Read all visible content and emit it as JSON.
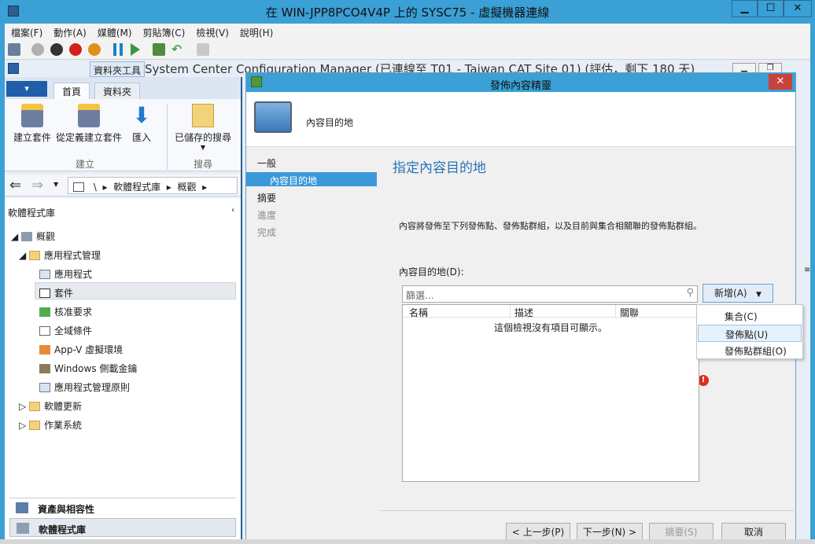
{
  "vm_window": {
    "title": "在 WIN-JPP8PCO4V4P 上的 SYSC75 - 虛擬機器連線",
    "minimize": "▁",
    "maximize": "☐",
    "close": "✕",
    "menu": [
      "檔案(F)",
      "動作(A)",
      "媒體(M)",
      "剪貼簿(C)",
      "檢視(V)",
      "說明(H)"
    ]
  },
  "cm_window": {
    "title": "System Center Configuration Manager (已連線至 T01 - Taiwan CAT Site 01) (評估，剩下 180 天)",
    "folder_tools": "資料夾工具",
    "tabs": [
      "首頁",
      "資料夾"
    ],
    "ribbon_buttons": [
      "建立套件",
      "從定義建立套件",
      "匯入",
      "已儲存的搜尋"
    ],
    "ribbon_groups": [
      "建立",
      "搜尋"
    ],
    "breadcrumb": [
      "\\",
      "軟體程式庫",
      "概觀"
    ],
    "sidebar_title": "軟體程式庫",
    "tree": {
      "overview": "概觀",
      "app_mgmt": "應用程式管理",
      "items": [
        "應用程式",
        "套件",
        "核准要求",
        "全域條件",
        "App-V 虛擬環境",
        "Windows 側載金鑰",
        "應用程式管理原則"
      ],
      "software_updates": "軟體更新",
      "os": "作業系統"
    },
    "workspaces": [
      "資產與相容性",
      "軟體程式庫"
    ]
  },
  "wizard": {
    "title": "發佈內容精靈",
    "header": "內容目的地",
    "steps": [
      "一般",
      "內容目的地",
      "摘要",
      "進度",
      "完成"
    ],
    "active_step": 1,
    "heading": "指定內容目的地",
    "description": "內容將發佈至下列發佈點、發佈點群組，以及目前與集合相關聯的發佈點群組。",
    "list_label": "內容目的地(D):",
    "filter_placeholder": "篩選...",
    "columns": [
      "名稱",
      "描述",
      "關聯"
    ],
    "empty_message": "這個檢視沒有項目可顯示。",
    "add_button": "新增(A)",
    "add_menu": [
      "集合(C)",
      "發佈點(U)",
      "發佈點群組(O)"
    ],
    "highlighted_menu_index": 1,
    "footer_buttons": [
      "< 上一步(P)",
      "下一步(N) >",
      "摘要(S)",
      "取消"
    ],
    "colors": {
      "title_bar": "#3aa0d6",
      "heading": "#2a73b8",
      "close": "#c7423b",
      "error": "#d9301f"
    }
  }
}
